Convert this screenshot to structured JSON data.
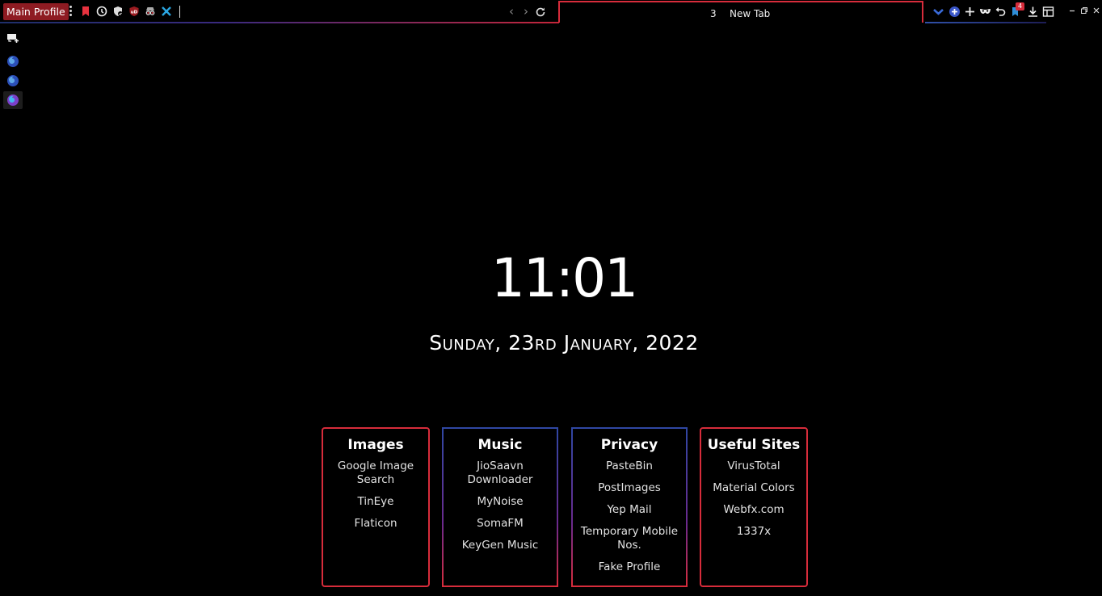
{
  "toolbar": {
    "profile_label": "Main Profile",
    "extensions": [
      "bookmark-icon",
      "history-icon",
      "shield-check-icon",
      "ublock-icon",
      "incognito-icon",
      "crossed-tools-icon"
    ]
  },
  "tab": {
    "number": "3",
    "title": "New Tab"
  },
  "toolbar_right": {
    "notification_count": "4"
  },
  "clock": {
    "time": "11:01",
    "date": "Sunday, 23rd January, 2022"
  },
  "cards": [
    {
      "title": "Images",
      "links": [
        "Google Image Search",
        "TinEye",
        "Flaticon"
      ]
    },
    {
      "title": "Music",
      "links": [
        "JioSaavn Downloader",
        "MyNoise",
        "SomaFM",
        "KeyGen Music"
      ]
    },
    {
      "title": "Privacy",
      "links": [
        "PasteBin",
        "PostImages",
        "Yep Mail",
        "Temporary Mobile Nos.",
        "Fake Profile"
      ]
    },
    {
      "title": "Useful Sites",
      "links": [
        "VirusTotal",
        "Material Colors",
        "Webfx.com",
        "1337x"
      ]
    }
  ],
  "colors": {
    "accent_red": "#d72c3b",
    "accent_blue": "#2f47a3",
    "background": "#000000"
  }
}
